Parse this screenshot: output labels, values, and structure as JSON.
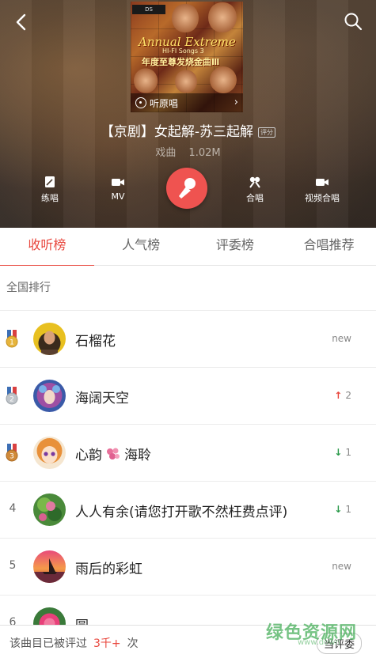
{
  "header": {
    "cover": {
      "logo_text": "DS",
      "title_en": "Annual Extreme",
      "subtitle_en": "HI-FI Songs 3",
      "title_cn": "年度至尊发烧金曲Ⅲ",
      "listen_original_label": "听原唱"
    },
    "song_title": "【京剧】女起解-苏三起解",
    "song_tag": "评分",
    "genre": "戏曲",
    "file_size": "1.02M",
    "actions": {
      "practice": "练唱",
      "mv": "MV",
      "chorus": "合唱",
      "video_chorus": "视频合唱"
    }
  },
  "tabs": [
    {
      "label": "收听榜",
      "active": true
    },
    {
      "label": "人气榜",
      "active": false
    },
    {
      "label": "评委榜",
      "active": false
    },
    {
      "label": "合唱推荐",
      "active": false
    }
  ],
  "ranking": {
    "section_title": "全国排行",
    "rows": [
      {
        "rank": "1",
        "name": "石榴花",
        "trend": "new",
        "trend_dir": "new",
        "medal": "gold"
      },
      {
        "rank": "2",
        "name": "海阔天空",
        "trend": "2",
        "trend_dir": "up",
        "medal": "silver"
      },
      {
        "rank": "3",
        "name_a": "心韵",
        "name_b": "海聆",
        "trend": "1",
        "trend_dir": "down",
        "medal": "bronze"
      },
      {
        "rank": "4",
        "name": "人人有余(请您打开歌不然枉费点评)",
        "trend": "1",
        "trend_dir": "down"
      },
      {
        "rank": "5",
        "name": "雨后的彩虹",
        "trend": "new",
        "trend_dir": "new"
      },
      {
        "rank": "6",
        "name": "圆",
        "trend": "",
        "trend_dir": "none"
      }
    ]
  },
  "footer": {
    "text_before": "该曲目已被评过",
    "count": "3千+",
    "text_after": "次",
    "judge_button": "当评委"
  },
  "watermark": {
    "main": "绿色资源网",
    "sub": "www.down"
  },
  "colors": {
    "accent": "#e8463c",
    "mic_button": "#ef5350",
    "trend_down": "#2a9a4a"
  }
}
